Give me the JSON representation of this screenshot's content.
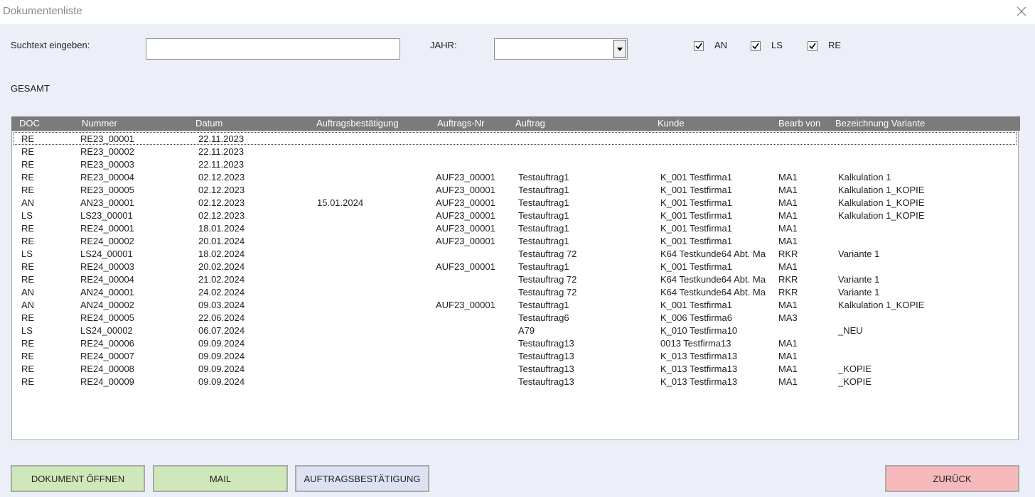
{
  "window": {
    "title": "Dokumentenliste"
  },
  "search": {
    "label": "Suchtext eingeben:",
    "value": ""
  },
  "year": {
    "label": "JAHR:",
    "value": ""
  },
  "filters": [
    {
      "label": "AN",
      "checked": true
    },
    {
      "label": "LS",
      "checked": true
    },
    {
      "label": "RE",
      "checked": true
    }
  ],
  "total": {
    "label": "GESAMT"
  },
  "columns": [
    "DOC",
    "Nummer",
    "Datum",
    "Auftragsbestätigung",
    "Auftrags-Nr",
    "Auftrag",
    "Kunde",
    "Bearb von",
    "Bezeichnung Variante"
  ],
  "rows": [
    [
      "RE",
      "RE23_00001",
      "22.11.2023",
      "",
      "",
      "",
      "",
      "",
      ""
    ],
    [
      "RE",
      "RE23_00002",
      "22.11.2023",
      "",
      "",
      "",
      "",
      "",
      ""
    ],
    [
      "RE",
      "RE23_00003",
      "22.11.2023",
      "",
      "",
      "",
      "",
      "",
      ""
    ],
    [
      "RE",
      "RE23_00004",
      "02.12.2023",
      "",
      "AUF23_00001",
      "Testauftrag1",
      "K_001 Testfirma1",
      "MA1",
      "Kalkulation 1"
    ],
    [
      "RE",
      "RE23_00005",
      "02.12.2023",
      "",
      "AUF23_00001",
      "Testauftrag1",
      "K_001 Testfirma1",
      "MA1",
      "Kalkulation 1_KOPIE"
    ],
    [
      "AN",
      "AN23_00001",
      "02.12.2023",
      "15.01.2024",
      "AUF23_00001",
      "Testauftrag1",
      "K_001 Testfirma1",
      "MA1",
      "Kalkulation 1_KOPIE"
    ],
    [
      "LS",
      "LS23_00001",
      "02.12.2023",
      "",
      "AUF23_00001",
      "Testauftrag1",
      "K_001 Testfirma1",
      "MA1",
      "Kalkulation 1_KOPIE"
    ],
    [
      "RE",
      "RE24_00001",
      "18.01.2024",
      "",
      "AUF23_00001",
      "Testauftrag1",
      "K_001 Testfirma1",
      "MA1",
      ""
    ],
    [
      "RE",
      "RE24_00002",
      "20.01.2024",
      "",
      "AUF23_00001",
      "Testauftrag1",
      "K_001 Testfirma1",
      "MA1",
      ""
    ],
    [
      "LS",
      "LS24_00001",
      "18.02.2024",
      "",
      "",
      "Testauftrag 72",
      "K64 Testkunde64 Abt. Ma",
      "RKR",
      "Variante 1"
    ],
    [
      "RE",
      "RE24_00003",
      "20.02.2024",
      "",
      "AUF23_00001",
      "Testauftrag1",
      "K_001 Testfirma1",
      "MA1",
      ""
    ],
    [
      "RE",
      "RE24_00004",
      "21.02.2024",
      "",
      "",
      "Testauftrag 72",
      "K64 Testkunde64 Abt. Ma",
      "RKR",
      "Variante 1"
    ],
    [
      "AN",
      "AN24_00001",
      "24.02.2024",
      "",
      "",
      "Testauftrag 72",
      "K64 Testkunde64 Abt. Ma",
      "RKR",
      "Variante 1"
    ],
    [
      "AN",
      "AN24_00002",
      "09.03.2024",
      "",
      "AUF23_00001",
      "Testauftrag1",
      "K_001 Testfirma1",
      "MA1",
      "Kalkulation 1_KOPIE"
    ],
    [
      "RE",
      "RE24_00005",
      "22.06.2024",
      "",
      "",
      "Testauftrag6",
      "K_006 Testfirma6",
      "MA3",
      ""
    ],
    [
      "LS",
      "LS24_00002",
      "06.07.2024",
      "",
      "",
      "A79",
      "K_010 Testfirma10",
      "",
      "_NEU"
    ],
    [
      "RE",
      "RE24_00006",
      "09.09.2024",
      "",
      "",
      "Testauftrag13",
      "0013 Testfirma13",
      "MA1",
      ""
    ],
    [
      "RE",
      "RE24_00007",
      "09.09.2024",
      "",
      "",
      "Testauftrag13",
      "K_013 Testfirma13",
      "MA1",
      ""
    ],
    [
      "RE",
      "RE24_00008",
      "09.09.2024",
      "",
      "",
      "Testauftrag13",
      "K_013 Testfirma13",
      "MA1",
      "_KOPIE"
    ],
    [
      "RE",
      "RE24_00009",
      "09.09.2024",
      "",
      "",
      "Testauftrag13",
      "K_013 Testfirma13",
      "MA1",
      "_KOPIE"
    ]
  ],
  "buttons": {
    "open": {
      "label": "DOKUMENT ÖFFNEN",
      "color": "#cfe8b9"
    },
    "mail": {
      "label": "MAIL",
      "color": "#cfe8b9"
    },
    "confirm": {
      "label": "AUFTRAGSBESTÄTIGUNG",
      "color": "#dde2f3"
    },
    "back": {
      "label": "ZURÜCK",
      "color": "#f7b9bb"
    }
  }
}
